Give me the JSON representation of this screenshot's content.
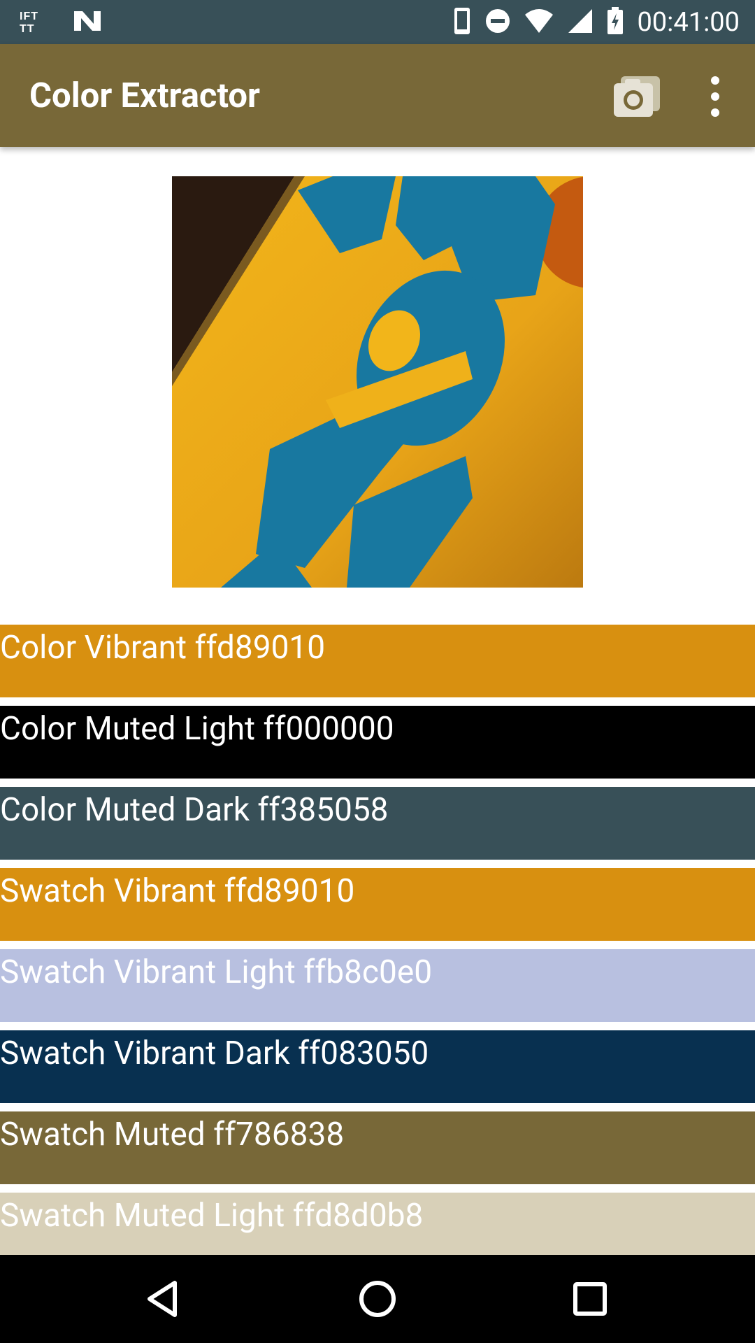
{
  "status_bar": {
    "time": "00:41:00",
    "left_icons": [
      "ifttt-icon",
      "n-icon"
    ],
    "right_icons": [
      "phone-icon",
      "do-not-disturb-icon",
      "wifi-icon",
      "cell-signal-icon",
      "battery-charging-icon"
    ],
    "ifttt_text": "IFTTT"
  },
  "app_bar": {
    "title": "Color Extractor",
    "actions": [
      "camera-icon",
      "more-vert-icon"
    ]
  },
  "swatches": [
    {
      "label": "Color Vibrant ffd89010",
      "color": "#d89010"
    },
    {
      "label": "Color Muted Light ff000000",
      "color": "#000000"
    },
    {
      "label": "Color Muted Dark ff385058",
      "color": "#385058"
    },
    {
      "label": "Swatch Vibrant ffd89010",
      "color": "#d89010"
    },
    {
      "label": "Swatch Vibrant Light ffb8c0e0",
      "color": "#b8c0e0"
    },
    {
      "label": "Swatch Vibrant Dark ff083050",
      "color": "#083050"
    },
    {
      "label": "Swatch Muted ff786838",
      "color": "#786838"
    },
    {
      "label": "Swatch Muted Light ffd8d0b8",
      "color": "#d8d0b8"
    }
  ],
  "nav_bar": {
    "buttons": [
      "back-icon",
      "home-icon",
      "recents-icon"
    ]
  }
}
